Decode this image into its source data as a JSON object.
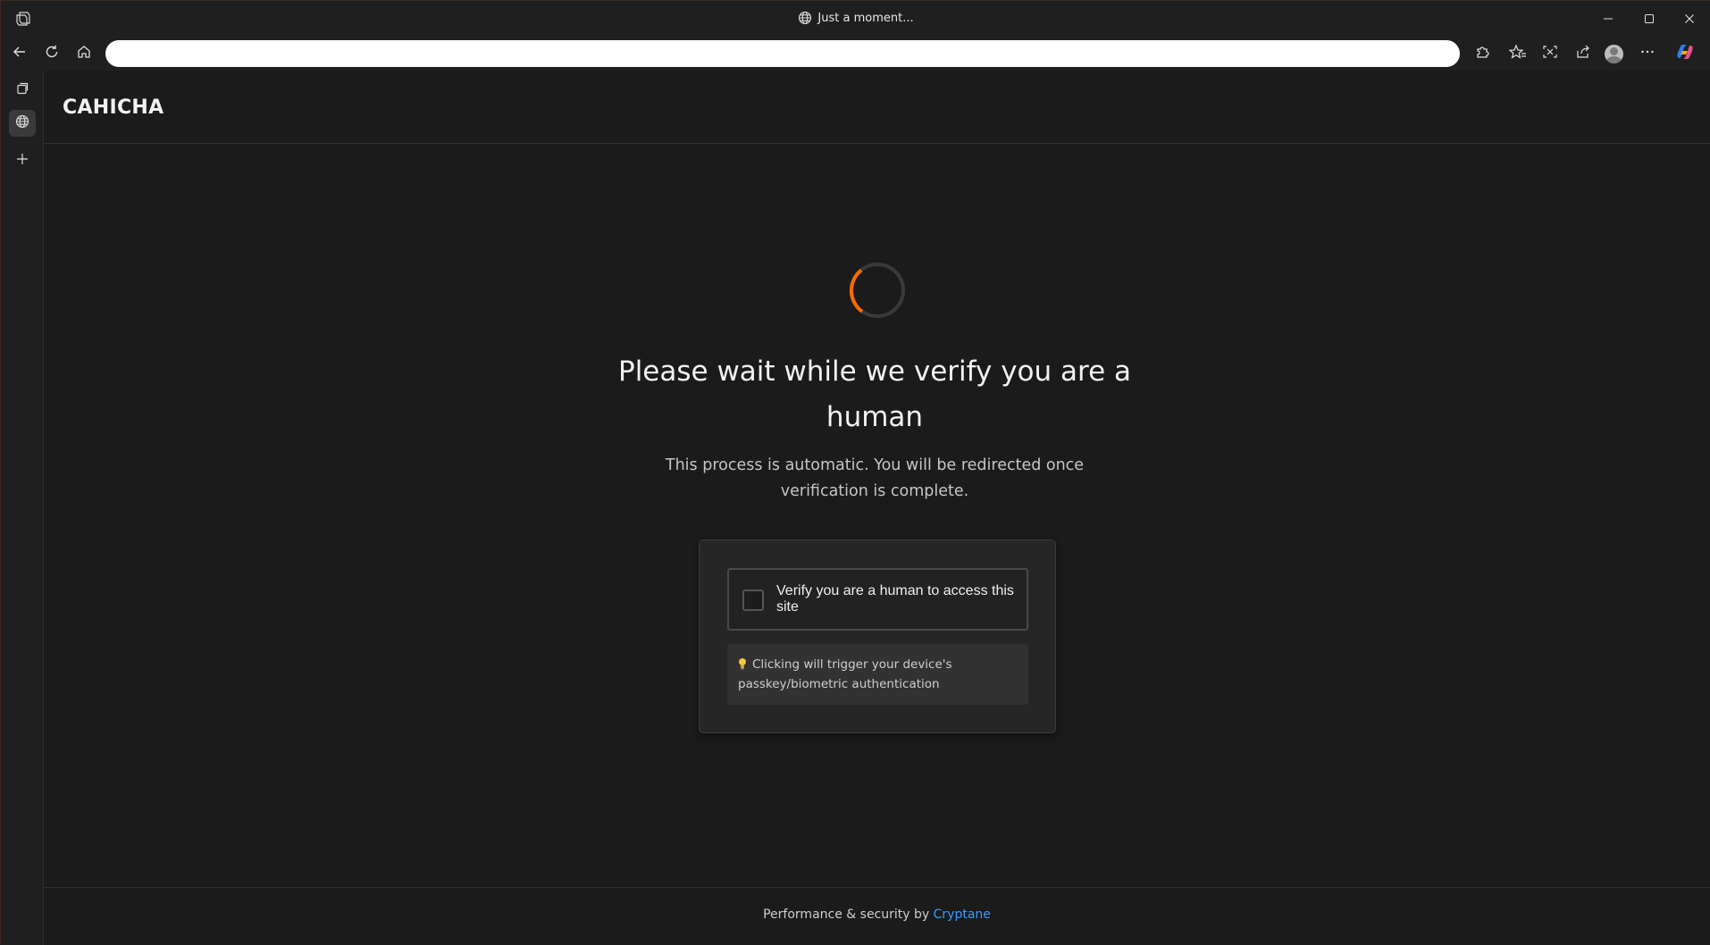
{
  "window": {
    "title": "Just a moment..."
  },
  "toolbar": {
    "address_value": ""
  },
  "site": {
    "brand": "CAHICHA"
  },
  "main": {
    "heading": "Please wait while we verify you are a human",
    "subtext": "This process is automatic. You will be redirected once verification is complete.",
    "verify_label": "Verify you are a human to access this site",
    "hint": "Clicking will trigger your device's passkey/biometric authentication"
  },
  "footer": {
    "prefix": "Performance & security by ",
    "link_label": "Cryptane"
  },
  "colors": {
    "spinner_accent": "#ff6a00",
    "link": "#3b9cff"
  },
  "icons": [
    "app-menu-icon",
    "globe-icon",
    "minimize-icon",
    "maximize-icon",
    "close-icon",
    "back-icon",
    "refresh-icon",
    "home-icon",
    "extensions-icon",
    "favorites-icon",
    "screenshot-icon",
    "share-icon",
    "more-icon",
    "copilot-icon",
    "tab-actions-icon",
    "new-tab-icon",
    "lightbulb-icon"
  ]
}
